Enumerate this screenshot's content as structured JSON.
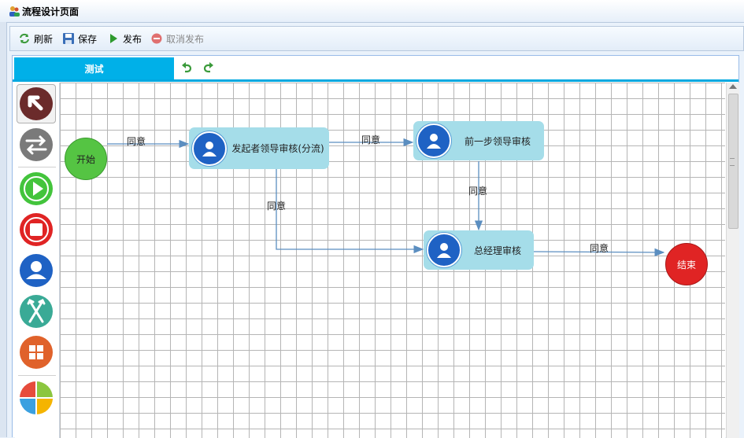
{
  "window": {
    "title": "流程设计页面",
    "icon": "user-group-icon"
  },
  "toolbar": {
    "refresh_label": "刷新",
    "save_label": "保存",
    "publish_label": "发布",
    "unpublish_label": "取消发布"
  },
  "tabs": {
    "active_label": "测试",
    "undo_icon": "undo-icon",
    "redo_icon": "redo-icon"
  },
  "palette": [
    {
      "name": "select-tool",
      "icon": "arrow-up-left-icon",
      "color": "#6b2b2b"
    },
    {
      "name": "connector-tool",
      "icon": "swap-arrows-icon",
      "color": "#7a7a7a"
    },
    {
      "name": "start-tool",
      "icon": "play-icon",
      "color": "#43c43c"
    },
    {
      "name": "end-tool",
      "icon": "stop-icon",
      "color": "#e02424"
    },
    {
      "name": "task-tool",
      "icon": "user-icon",
      "color": "#1f62c4"
    },
    {
      "name": "branch-tool",
      "icon": "split-arrows-icon",
      "color": "#3aaa96"
    },
    {
      "name": "subprocess-tool",
      "icon": "grid-icon",
      "color": "#e0622b"
    },
    {
      "name": "pie-tool",
      "icon": "pie-icon",
      "color": "#e64c3c"
    }
  ],
  "diagram": {
    "nodes": {
      "start": {
        "label": "开始",
        "color": "#55c443"
      },
      "n1": {
        "label": "发起者领导审核(分流)"
      },
      "n2": {
        "label": "前一步领导审核"
      },
      "n3": {
        "label": "总经理审核"
      },
      "end": {
        "label": "结束",
        "color": "#e02424"
      }
    },
    "edges": {
      "e1": "同意",
      "e2": "同意",
      "e3": "同意",
      "e4": "同意",
      "e5": "同意"
    },
    "colors": {
      "edge": "#5b8ec0",
      "node_fill": "#a5dde9",
      "accent": "#00b0e8"
    }
  }
}
